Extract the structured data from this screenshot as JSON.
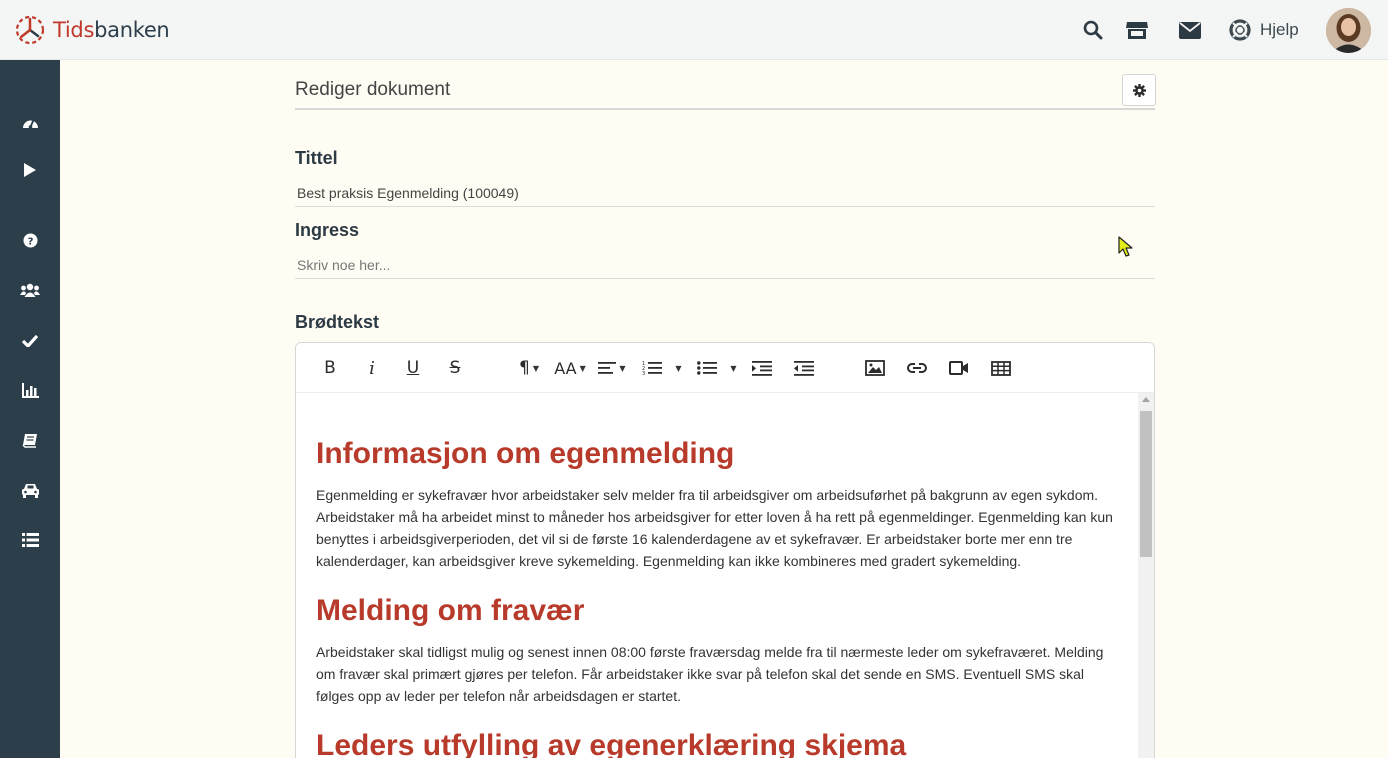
{
  "app": {
    "brand_part1": "Tids",
    "brand_part2": "banken"
  },
  "topbar": {
    "help_label": "Hjelp",
    "icons": [
      "search-icon",
      "store-icon",
      "mail-icon",
      "lifebuoy-icon"
    ]
  },
  "sidebar": {
    "items": [
      "dashboard-icon",
      "play-icon",
      "help-circle-icon",
      "users-icon",
      "check-icon",
      "bar-chart-icon",
      "book-icon",
      "car-icon",
      "list-icon"
    ]
  },
  "page": {
    "title": "Rediger dokument",
    "settings_icon": "gear-icon"
  },
  "form": {
    "title_label": "Tittel",
    "title_value": "Best praksis Egenmelding (100049)",
    "ingress_label": "Ingress",
    "ingress_placeholder": "Skriv noe her...",
    "body_label": "Brødtekst"
  },
  "toolbar": {
    "bold": "B",
    "italic": "i",
    "underline": "U",
    "strikethrough": "S",
    "font_size": "AA",
    "paragraph": "¶"
  },
  "document": {
    "h1": "Informasjon om egenmelding",
    "p1": "Egenmelding er sykefravær hvor arbeidstaker selv melder fra til arbeidsgiver om arbeidsuførhet på bakgrunn av egen sykdom. Arbeidstaker må ha arbeidet minst to måneder hos arbeidsgiver for etter loven å ha rett på egenmeldinger. Egenmelding kan kun benyttes i arbeidsgiverperioden, det vil si de første 16 kalenderdagene av et sykefravær. Er arbeidstaker borte mer enn tre kalenderdager, kan arbeidsgiver kreve sykemelding. Egenmelding kan ikke kombineres med gradert sykemelding.",
    "h2": "Melding om fravær",
    "p2": "Arbeidstaker skal tidligst mulig og senest innen 08:00 første fraværsdag melde fra til nærmeste leder om sykefraværet. Melding om fravær skal primært gjøres per telefon. Får arbeidstaker ikke svar på telefon skal det sende en SMS. Eventuell SMS skal følges opp av leder per telefon når arbeidsdagen er startet.",
    "h3": "Leders utfylling av egenerklæring skjema"
  },
  "colors": {
    "accent": "#b83a2a",
    "sidebar": "#2c3e4a",
    "background": "#fffcf4"
  }
}
